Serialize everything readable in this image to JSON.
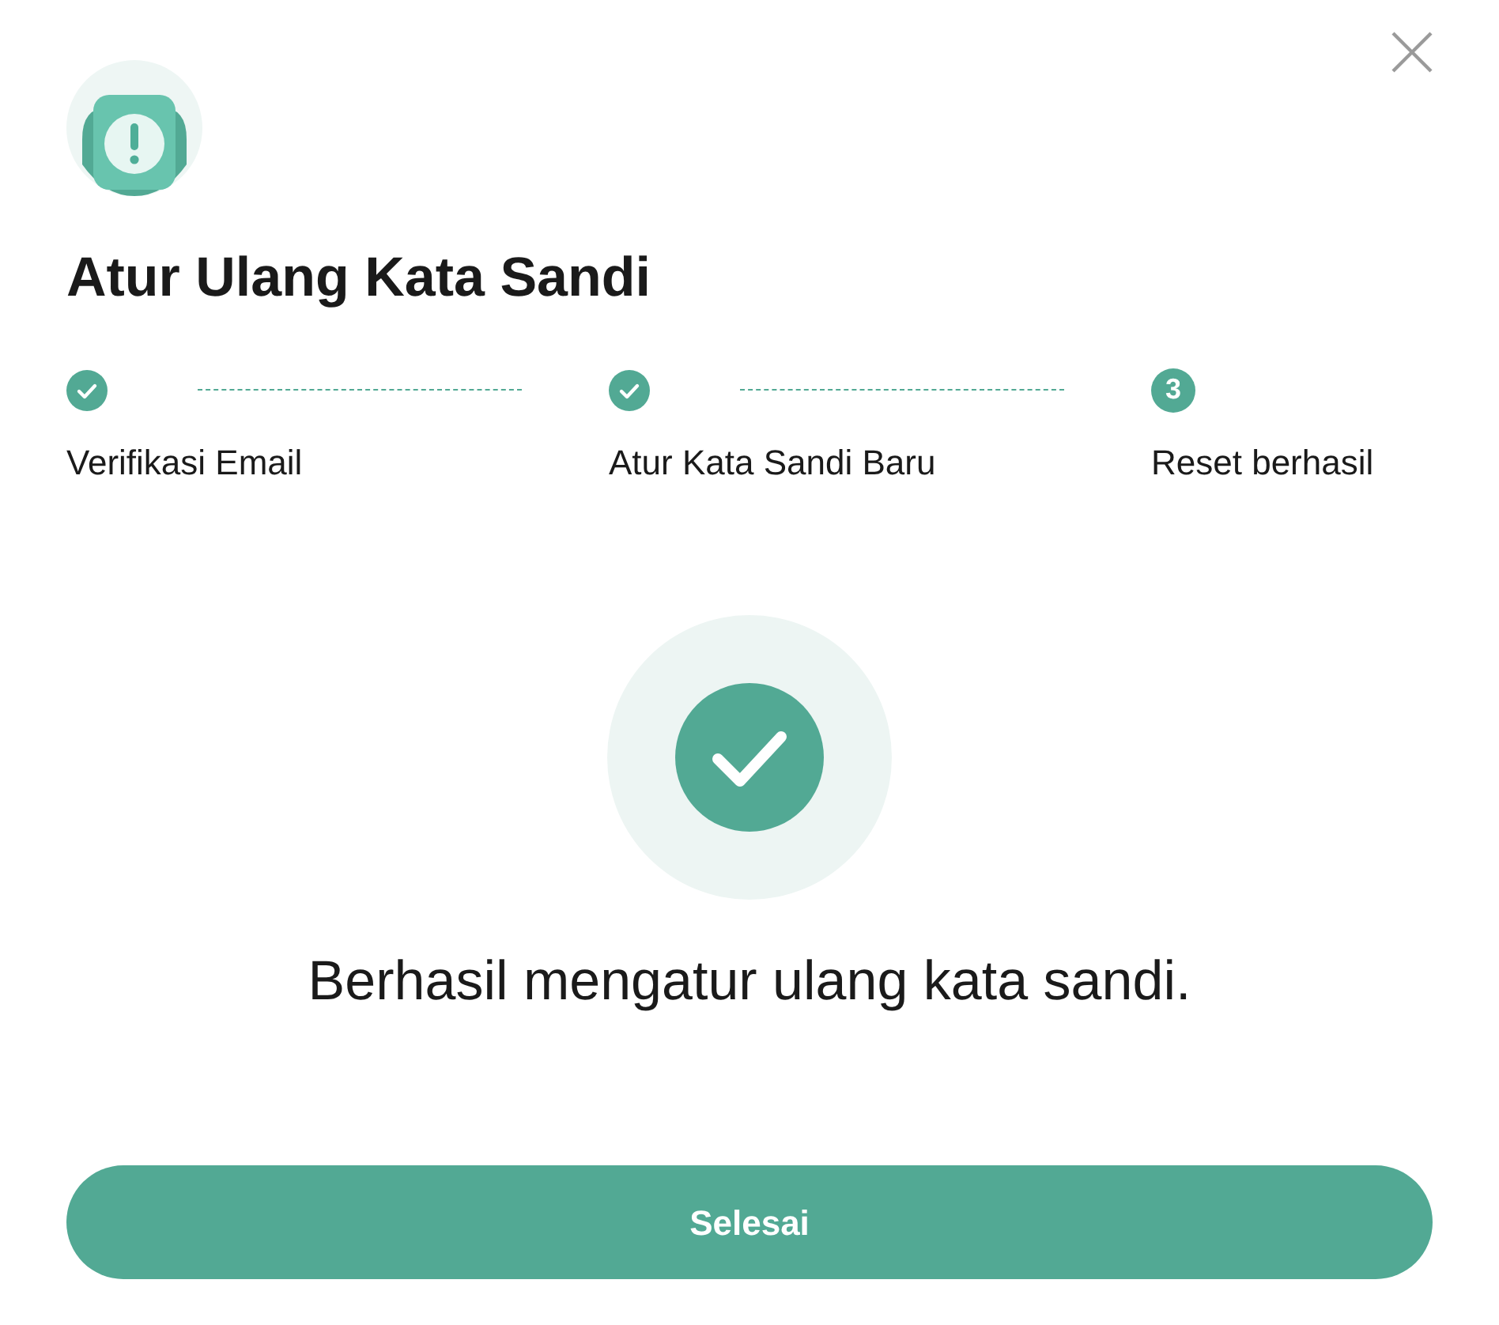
{
  "dialog": {
    "title": "Atur Ulang Kata Sandi"
  },
  "steps": [
    {
      "label": "Verifikasi Email",
      "completed": true
    },
    {
      "label": "Atur Kata Sandi Baru",
      "completed": true
    },
    {
      "label": "Reset berhasil",
      "completed": false,
      "number": "3"
    }
  ],
  "message": "Berhasil mengatur ulang kata sandi.",
  "buttons": [
    "Selesai"
  ]
}
